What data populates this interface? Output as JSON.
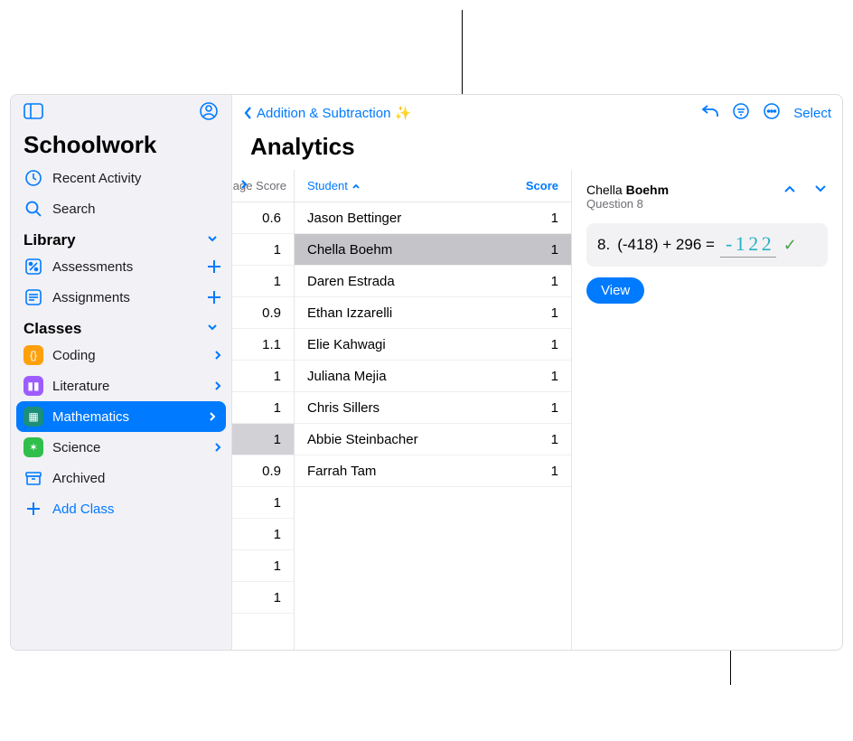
{
  "app_title": "Schoolwork",
  "sidebar": {
    "recent": "Recent Activity",
    "search": "Search",
    "library_header": "Library",
    "assessments": "Assessments",
    "assignments": "Assignments",
    "classes_header": "Classes",
    "coding": "Coding",
    "literature": "Literature",
    "mathematics": "Mathematics",
    "science": "Science",
    "archived": "Archived",
    "add_class": "Add Class"
  },
  "main": {
    "back_label": "Addition & Subtraction ✨",
    "title": "Analytics",
    "select": "Select"
  },
  "scores": {
    "header": "age Score",
    "rows": [
      "0.6",
      "1",
      "1",
      "0.9",
      "1.1",
      "1",
      "1",
      "1",
      "0.9",
      "1",
      "1",
      "1",
      "1"
    ],
    "selected_index": 7
  },
  "students": {
    "student_header": "Student",
    "score_header": "Score",
    "rows": [
      {
        "name": "Jason Bettinger",
        "score": "1"
      },
      {
        "name": "Chella Boehm",
        "score": "1"
      },
      {
        "name": "Daren Estrada",
        "score": "1"
      },
      {
        "name": "Ethan Izzarelli",
        "score": "1"
      },
      {
        "name": "Elie Kahwagi",
        "score": "1"
      },
      {
        "name": "Juliana Mejia",
        "score": "1"
      },
      {
        "name": "Chris Sillers",
        "score": "1"
      },
      {
        "name": "Abbie Steinbacher",
        "score": "1"
      },
      {
        "name": "Farrah Tam",
        "score": "1"
      }
    ],
    "selected_index": 1
  },
  "detail": {
    "name_first": "Chella ",
    "name_last": "Boehm",
    "subtitle": "Question 8",
    "qnum": "8.",
    "problem": "(-418) + 296 =",
    "handwritten": "- 1 2 2",
    "view": "View"
  }
}
